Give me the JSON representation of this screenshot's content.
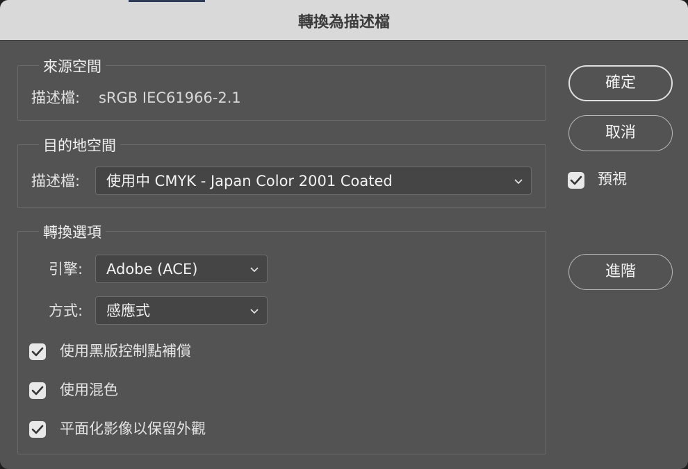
{
  "window": {
    "title": "轉換為描述檔"
  },
  "source_space": {
    "legend": "來源空間",
    "profile_label": "描述檔:",
    "profile_value": "sRGB IEC61966-2.1"
  },
  "destination_space": {
    "legend": "目的地空間",
    "profile_label": "描述檔:",
    "profile_value": "使用中 CMYK - Japan Color 2001 Coated"
  },
  "conversion_options": {
    "legend": "轉換選項",
    "engine_label": "引擎:",
    "engine_value": "Adobe (ACE)",
    "intent_label": "方式:",
    "intent_value": "感應式",
    "options": [
      {
        "label": "使用黑版控制點補償",
        "checked": true
      },
      {
        "label": "使用混色",
        "checked": true
      },
      {
        "label": "平面化影像以保留外觀",
        "checked": true
      }
    ]
  },
  "buttons": {
    "ok": "確定",
    "cancel": "取消",
    "advanced": "進階"
  },
  "preview": {
    "label": "預視",
    "checked": true
  }
}
